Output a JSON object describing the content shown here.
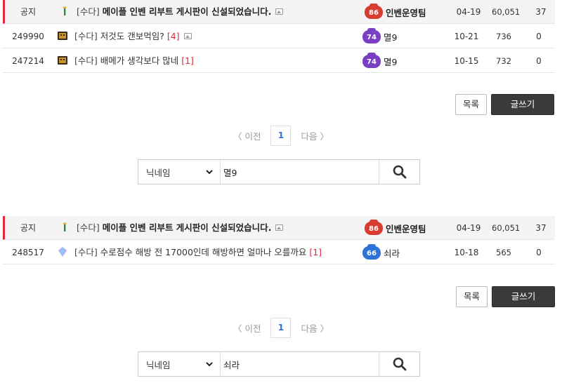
{
  "boards": [
    {
      "rows": [
        {
          "num": "공지",
          "category": "[수다]",
          "title": "메이플 인벤 리부트 게시판이 신설되었습니다.",
          "bold": true,
          "comment_count": "",
          "has_image": true,
          "author": "인벤운영팀",
          "author_bold": true,
          "level": "86",
          "level_color": "red",
          "thumb_icon": "notice-icon",
          "date": "04-19",
          "views": "60,051",
          "likes": "37"
        },
        {
          "num": "249990",
          "category": "[수다]",
          "title": "저것도 갠보먹임?",
          "bold": false,
          "comment_count": "[4]",
          "has_image": true,
          "author": "멸9",
          "author_bold": false,
          "level": "74",
          "level_color": "purple",
          "thumb_icon": "character-icon",
          "date": "10-21",
          "views": "736",
          "likes": "0"
        },
        {
          "num": "247214",
          "category": "[수다]",
          "title": "배메가 생각보다 많네",
          "bold": false,
          "comment_count": "[1]",
          "has_image": false,
          "author": "멸9",
          "author_bold": false,
          "level": "74",
          "level_color": "purple",
          "thumb_icon": "character-icon",
          "date": "10-15",
          "views": "732",
          "likes": "0"
        }
      ],
      "buttons": {
        "list": "목록",
        "write": "글쓰기"
      },
      "pager": {
        "prev": "〈 이전",
        "current": "1",
        "next": "다음 〉"
      },
      "search": {
        "field": "닉네임",
        "query": "멸9"
      }
    },
    {
      "rows": [
        {
          "num": "공지",
          "category": "[수다]",
          "title": "메이플 인벤 리부트 게시판이 신설되었습니다.",
          "bold": true,
          "comment_count": "",
          "has_image": true,
          "author": "인벤운영팀",
          "author_bold": true,
          "level": "86",
          "level_color": "red",
          "thumb_icon": "notice-icon",
          "date": "04-19",
          "views": "60,051",
          "likes": "37"
        },
        {
          "num": "248517",
          "category": "[수다]",
          "title": "수로점수 해방 전 17000인데 해방하면 얼마나 오를까요",
          "bold": false,
          "comment_count": "[1]",
          "has_image": false,
          "author": "쇠라",
          "author_bold": false,
          "level": "66",
          "level_color": "blue",
          "thumb_icon": "gem-icon",
          "date": "10-18",
          "views": "565",
          "likes": "0"
        }
      ],
      "buttons": {
        "list": "목록",
        "write": "글쓰기"
      },
      "pager": {
        "prev": "〈 이전",
        "current": "1",
        "next": "다음 〉"
      },
      "search": {
        "field": "닉네임",
        "query": "쇠라"
      }
    }
  ],
  "colors": {
    "accent_red": "#e0273b",
    "page_blue": "#2f73d8",
    "write_button": "#3a3a3a"
  }
}
